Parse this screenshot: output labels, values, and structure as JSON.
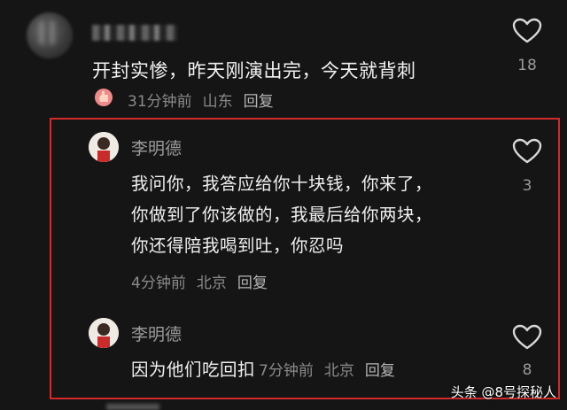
{
  "comment": {
    "text": "开封实惨，昨天刚演出完，今天就背刺",
    "time": "31分钟前",
    "location": "山东",
    "reply_label": "回复",
    "like_count": "18"
  },
  "replies": [
    {
      "username": "李明德",
      "lines": [
        "我问你，我答应给你十块钱，你来了，",
        "你做到了你该做的，我最后给你两块，",
        "你还得陪我喝到吐，你忍吗"
      ],
      "time": "4分钟前",
      "location": "北京",
      "reply_label": "回复",
      "like_count": "3"
    },
    {
      "username": "李明德",
      "text": "因为他们吃回扣",
      "time": "7分钟前",
      "location": "北京",
      "reply_label": "回复",
      "like_count": "8"
    }
  ],
  "watermark": "头条 @8号探秘人",
  "colors": {
    "highlight_border": "#d42a2a",
    "background": "#151515"
  }
}
